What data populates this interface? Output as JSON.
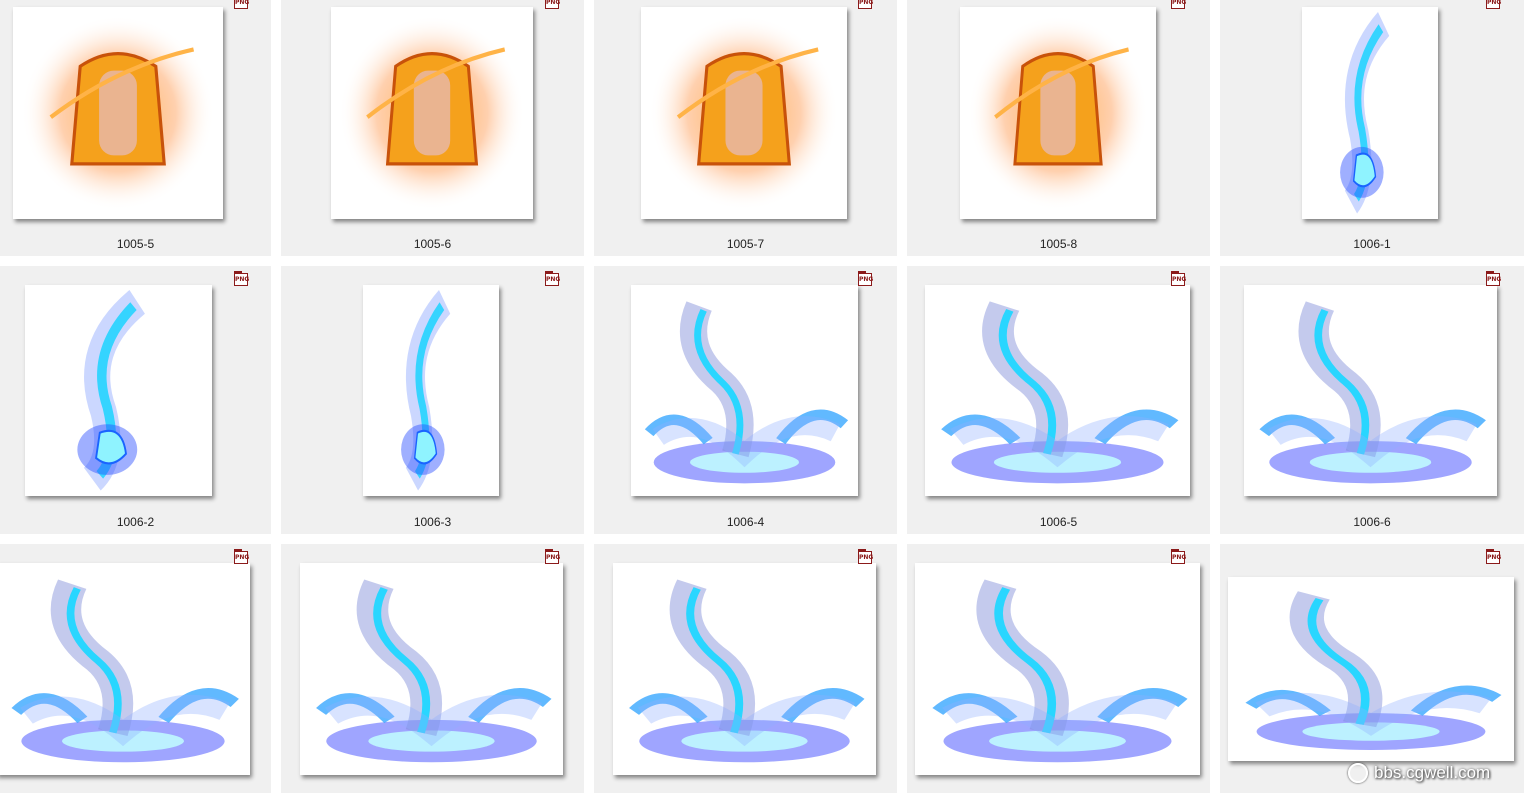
{
  "files": [
    {
      "label": "1005-5",
      "type": "PNG",
      "art": "bell"
    },
    {
      "label": "1005-6",
      "type": "PNG",
      "art": "bell"
    },
    {
      "label": "1005-7",
      "type": "PNG",
      "art": "bell"
    },
    {
      "label": "1005-8",
      "type": "PNG",
      "art": "bell"
    },
    {
      "label": "1006-1",
      "type": "PNG",
      "art": "dragon"
    },
    {
      "label": "1006-2",
      "type": "PNG",
      "art": "dragon"
    },
    {
      "label": "1006-3",
      "type": "PNG",
      "art": "dragon"
    },
    {
      "label": "1006-4",
      "type": "PNG",
      "art": "splash"
    },
    {
      "label": "1006-5",
      "type": "PNG",
      "art": "splash"
    },
    {
      "label": "1006-6",
      "type": "PNG",
      "art": "splash"
    },
    {
      "label": "",
      "type": "PNG",
      "art": "splash"
    },
    {
      "label": "",
      "type": "PNG",
      "art": "splash"
    },
    {
      "label": "",
      "type": "PNG",
      "art": "splash"
    },
    {
      "label": "",
      "type": "PNG",
      "art": "splash"
    },
    {
      "label": "",
      "type": "PNG",
      "art": "splash"
    }
  ],
  "watermark": {
    "text": "bbs.cgwell.com",
    "icon": "cgwell-logo-icon"
  },
  "colors": {
    "background": "#f0f0f0",
    "fire": "#ff8a00",
    "water": "#2f6bff"
  }
}
